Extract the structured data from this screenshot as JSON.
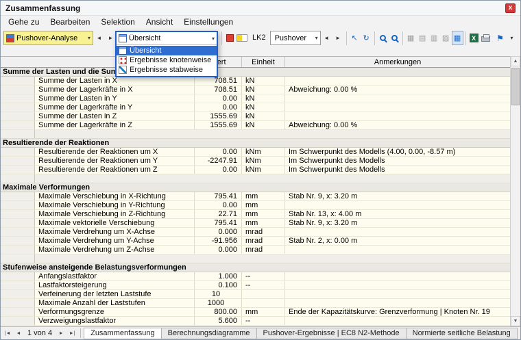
{
  "window": {
    "title": "Zusammenfassung"
  },
  "menu": {
    "items": [
      {
        "label": "Gehe zu"
      },
      {
        "label": "Bearbeiten"
      },
      {
        "label": "Selektion"
      },
      {
        "label": "Ansicht"
      },
      {
        "label": "Einstellungen"
      }
    ]
  },
  "toolbar": {
    "analysis_combo": {
      "value": "Pushover-Analyse"
    },
    "view_combo": {
      "value": "Übersicht"
    },
    "view_dropdown": {
      "items": [
        {
          "label": "Übersicht",
          "icon": "overview-icon",
          "selected": true
        },
        {
          "label": "Ergebnisse knotenweise",
          "icon": "nodes-icon",
          "selected": false
        },
        {
          "label": "Ergebnisse stabweise",
          "icon": "members-icon",
          "selected": false
        }
      ]
    },
    "lk_label": "LK2",
    "case_combo": {
      "value": "Pushover"
    }
  },
  "table": {
    "headers": {
      "wert": "Wert",
      "einheit": "Einheit",
      "anmerkungen": "Anmerkungen"
    },
    "rows": [
      {
        "type": "section",
        "label": "Summe der Lasten und die Summe der Lagerkräfte"
      },
      {
        "type": "data",
        "label": "Summe der Lasten in X",
        "wert": "708.51",
        "einheit": "kN",
        "anm": ""
      },
      {
        "type": "data",
        "label": "Summe der Lagerkräfte in X",
        "wert": "708.51",
        "einheit": "kN",
        "anm": "Abweichung: 0.00 %"
      },
      {
        "type": "data",
        "label": "Summe der Lasten in Y",
        "wert": "0.00",
        "einheit": "kN",
        "anm": ""
      },
      {
        "type": "data",
        "label": "Summe der Lagerkräfte in Y",
        "wert": "0.00",
        "einheit": "kN",
        "anm": ""
      },
      {
        "type": "data",
        "label": "Summe der Lasten in Z",
        "wert": "1555.69",
        "einheit": "kN",
        "anm": ""
      },
      {
        "type": "data",
        "label": "Summe der Lagerkräfte in Z",
        "wert": "1555.69",
        "einheit": "kN",
        "anm": "Abweichung: 0.00 %"
      },
      {
        "type": "spacer"
      },
      {
        "type": "section",
        "label": "Resultierende der Reaktionen"
      },
      {
        "type": "data",
        "label": "Resultierende der Reaktionen um X",
        "wert": "0.00",
        "einheit": "kNm",
        "anm": "Im Schwerpunkt des Modells (4.00, 0.00, -8.57 m)"
      },
      {
        "type": "data",
        "label": "Resultierende der Reaktionen um Y",
        "wert": "-2247.91",
        "einheit": "kNm",
        "anm": "Im Schwerpunkt des Modells"
      },
      {
        "type": "data",
        "label": "Resultierende der Reaktionen um Z",
        "wert": "0.00",
        "einheit": "kNm",
        "anm": "Im Schwerpunkt des Modells"
      },
      {
        "type": "spacer"
      },
      {
        "type": "section",
        "label": "Maximale Verformungen"
      },
      {
        "type": "data",
        "label": "Maximale Verschiebung in X-Richtung",
        "wert": "795.41",
        "einheit": "mm",
        "anm": "Stab Nr. 9, x: 3.20 m"
      },
      {
        "type": "data",
        "label": "Maximale Verschiebung in Y-Richtung",
        "wert": "0.00",
        "einheit": "mm",
        "anm": ""
      },
      {
        "type": "data",
        "label": "Maximale Verschiebung in Z-Richtung",
        "wert": "22.71",
        "einheit": "mm",
        "anm": "Stab Nr. 13, x: 4.00 m"
      },
      {
        "type": "data",
        "label": "Maximale vektorielle Verschiebung",
        "wert": "795.41",
        "einheit": "mm",
        "anm": "Stab Nr. 9, x: 3.20 m"
      },
      {
        "type": "data",
        "label": "Maximale Verdrehung um X-Achse",
        "wert": "0.000",
        "einheit": "mrad",
        "anm": ""
      },
      {
        "type": "data",
        "label": "Maximale Verdrehung um Y-Achse",
        "wert": "-91.956",
        "einheit": "mrad",
        "anm": "Stab Nr. 2, x: 0.00 m"
      },
      {
        "type": "data",
        "label": "Maximale Verdrehung um Z-Achse",
        "wert": "0.000",
        "einheit": "mrad",
        "anm": ""
      },
      {
        "type": "spacer"
      },
      {
        "type": "section",
        "label": "Stufenweise ansteigende Belastungsverformungen"
      },
      {
        "type": "data",
        "label": "Anfangslastfaktor",
        "wert": "1.000",
        "einheit": "--",
        "anm": ""
      },
      {
        "type": "data",
        "label": "Lastfaktorsteigerung",
        "wert": "0.100",
        "einheit": "--",
        "anm": ""
      },
      {
        "type": "data",
        "label": "Verfeinerung der letzten Laststufe",
        "wert": "10",
        "einheit": "",
        "anm": "",
        "align": "center"
      },
      {
        "type": "data",
        "label": "Maximale Anzahl der Laststufen",
        "wert": "1000",
        "einheit": "",
        "anm": "",
        "align": "center"
      },
      {
        "type": "data",
        "label": "Verformungsgrenze",
        "wert": "800.00",
        "einheit": "mm",
        "anm": "Ende der Kapazitätskurve: Grenzverformung | Knoten Nr. 19"
      },
      {
        "type": "data",
        "label": "Verzweigungslastfaktor",
        "wert": "5.600",
        "einheit": "--",
        "anm": ""
      }
    ]
  },
  "statusbar": {
    "page_label": "1 von 4",
    "tabs": [
      {
        "label": "Zusammenfassung",
        "active": true
      },
      {
        "label": "Berechnungsdiagramme",
        "active": false
      },
      {
        "label": "Pushover-Ergebnisse | EC8 N2-Methode",
        "active": false
      },
      {
        "label": "Normierte seitliche Belastung",
        "active": false
      }
    ]
  },
  "icons": {
    "close": "x",
    "chevron_down": "▾",
    "arrow_left": "◄",
    "arrow_right": "►",
    "first_page": "|◄",
    "last_page": "►|",
    "scroll_up": "▲",
    "scroll_down": "▼",
    "pointer": "↖",
    "refresh": "↻",
    "grid": "▦",
    "rows_glyph": "▤",
    "columns_glyph": "▥",
    "hatch": "▨",
    "flag": "⚑",
    "excel_x": "X"
  },
  "colors": {
    "selection_blue": "#2f6ed0",
    "focus_border_blue": "#1f5fd0",
    "row_yellow": "#fdfcee",
    "section_gray": "#e9e8e3",
    "combo_yellow": "#f8f292",
    "close_red": "#cf3a3a",
    "toolbar_icon_blue": "#1565c0",
    "excel_green": "#1d7044",
    "swatch_red": "#e03c31",
    "swatch_yellow": "#f5d327"
  }
}
